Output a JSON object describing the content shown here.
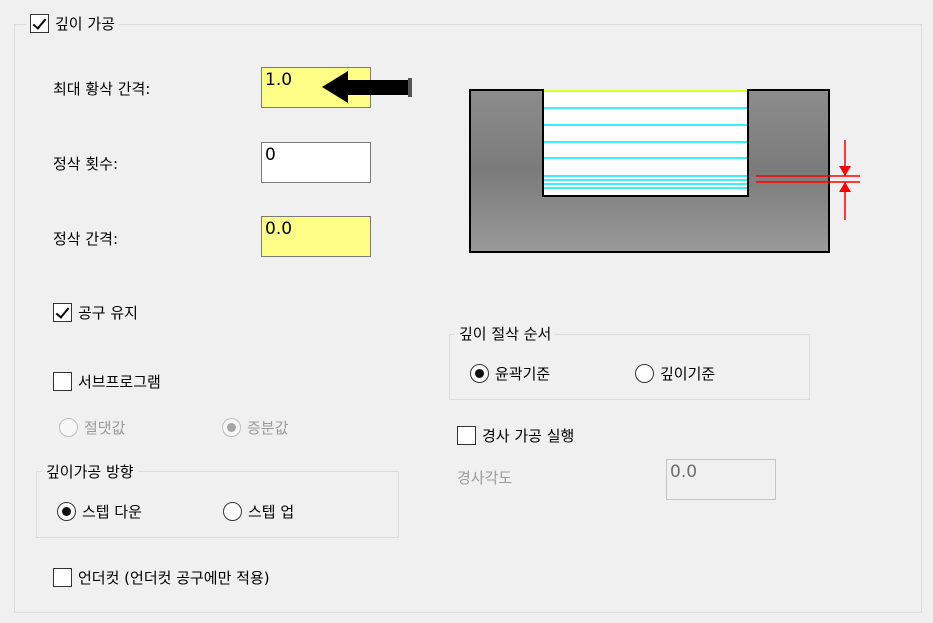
{
  "depth_machining": {
    "enabled_label": "깊이 가공",
    "enabled": true,
    "max_roughing_step_label": "최대 황삭 간격:",
    "max_roughing_step_value": "1.0",
    "finish_count_label": "정삭 횟수:",
    "finish_count_value": "0",
    "finish_step_label": "정삭 간격:",
    "finish_step_value": "0.0",
    "keep_tool_label": "공구 유지",
    "keep_tool_checked": true,
    "subprogram_label": "서브프로그램",
    "subprogram_checked": false,
    "absolute_label": "절댓값",
    "incremental_label": "증분값",
    "direction_group_label": "깊이가공 방향",
    "step_down_label": "스텝 다운",
    "step_up_label": "스텝 업",
    "undercut_label": "언더컷 (언더컷 공구에만 적용)",
    "undercut_checked": false,
    "cut_order_group_label": "깊이 절삭 순서",
    "by_contour_label": "윤곽기준",
    "by_depth_label": "깊이기준",
    "taper_label": "경사 가공 실행",
    "taper_checked": false,
    "taper_angle_label": "경사각도",
    "taper_angle_value": "0.0"
  },
  "colors": {
    "highlight_yellow": "#ffff88",
    "pass_line_cyan": "#00e5ff",
    "top_line_yellow": "#d8ff2a",
    "dimension_red": "#ff0000"
  }
}
